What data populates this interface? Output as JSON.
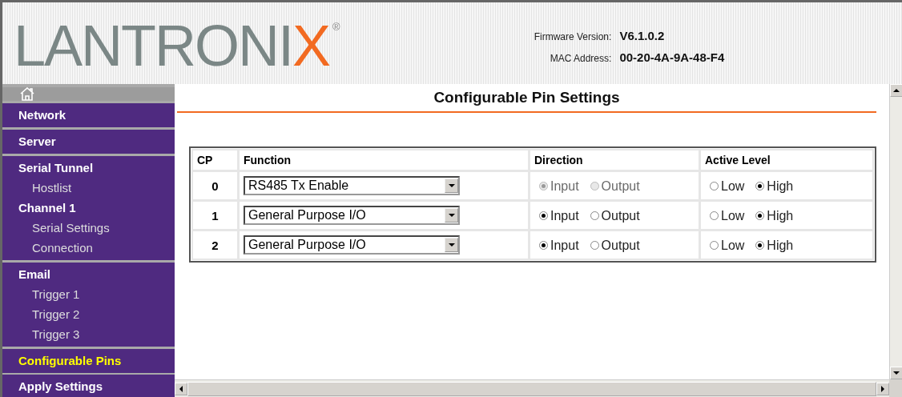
{
  "header": {
    "logo": {
      "text": "LANTRONI",
      "accent": "X",
      "mark": "®"
    },
    "firmware": {
      "label": "Firmware Version:",
      "value": "V6.1.0.2"
    },
    "mac": {
      "label": "MAC Address:",
      "value": "00-20-4A-9A-48-F4"
    }
  },
  "sidebar": {
    "groups": [
      {
        "items": [
          {
            "label": "Network",
            "kind": "header",
            "selected": false
          }
        ]
      },
      {
        "items": [
          {
            "label": "Server",
            "kind": "header",
            "selected": false
          }
        ]
      },
      {
        "items": [
          {
            "label": "Serial Tunnel",
            "kind": "header",
            "selected": false
          },
          {
            "label": "Hostlist",
            "kind": "sub",
            "selected": false
          },
          {
            "label": "Channel 1",
            "kind": "header",
            "selected": false
          },
          {
            "label": "Serial Settings",
            "kind": "sub",
            "selected": false
          },
          {
            "label": "Connection",
            "kind": "sub",
            "selected": false
          }
        ]
      },
      {
        "items": [
          {
            "label": "Email",
            "kind": "header",
            "selected": false
          },
          {
            "label": "Trigger 1",
            "kind": "sub",
            "selected": false
          },
          {
            "label": "Trigger 2",
            "kind": "sub",
            "selected": false
          },
          {
            "label": "Trigger 3",
            "kind": "sub",
            "selected": false
          }
        ]
      },
      {
        "items": [
          {
            "label": "Configurable Pins",
            "kind": "header",
            "selected": true
          }
        ]
      }
    ],
    "apply": "Apply Settings"
  },
  "main": {
    "title": "Configurable Pin Settings",
    "table": {
      "columns": [
        "CP",
        "Function",
        "Direction",
        "Active Level"
      ],
      "rows": [
        {
          "cp": "0",
          "function": "RS485 Tx Enable",
          "direction": {
            "disabled": true,
            "options": [
              {
                "label": "Input",
                "selected": true
              },
              {
                "label": "Output",
                "selected": false
              }
            ]
          },
          "active_level": {
            "disabled": false,
            "options": [
              {
                "label": "Low",
                "selected": false
              },
              {
                "label": "High",
                "selected": true
              }
            ]
          }
        },
        {
          "cp": "1",
          "function": "General Purpose I/O",
          "direction": {
            "disabled": false,
            "options": [
              {
                "label": "Input",
                "selected": true
              },
              {
                "label": "Output",
                "selected": false
              }
            ]
          },
          "active_level": {
            "disabled": false,
            "options": [
              {
                "label": "Low",
                "selected": false
              },
              {
                "label": "High",
                "selected": true
              }
            ]
          }
        },
        {
          "cp": "2",
          "function": "General Purpose I/O",
          "direction": {
            "disabled": false,
            "options": [
              {
                "label": "Input",
                "selected": true
              },
              {
                "label": "Output",
                "selected": false
              }
            ]
          },
          "active_level": {
            "disabled": false,
            "options": [
              {
                "label": "Low",
                "selected": false
              },
              {
                "label": "High",
                "selected": true
              }
            ]
          }
        }
      ]
    }
  }
}
